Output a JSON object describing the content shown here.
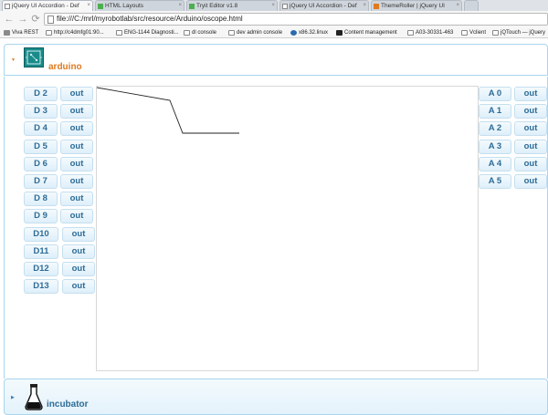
{
  "browser": {
    "tabs": [
      {
        "label": "jQuery UI Accordion - Def",
        "active": true
      },
      {
        "label": "HTML Layouts",
        "active": false
      },
      {
        "label": "Tryit Editor v1.8",
        "active": false
      },
      {
        "label": "jQuery UI Accordion - Def",
        "active": false
      },
      {
        "label": "ThemeRoller | jQuery UI",
        "active": false
      }
    ],
    "url": "file:///C:/mrl/myrobotlab/src/resource/Arduino/oscope.html",
    "bookmarks": [
      "Viva REST",
      "http://c4dmfg01:90...",
      "ENG-1144 Diagnosti...",
      "dl console",
      "dev admin console",
      "x86.32.linux",
      "Content management",
      "A03-30331-463",
      "Vclient",
      "jQTouch — jQuery"
    ]
  },
  "accordion": {
    "arduino_title": "arduino",
    "incubator_title": "incubator"
  },
  "digital_pins": [
    "D 2",
    "D 3",
    "D 4",
    "D 5",
    "D 6",
    "D 7",
    "D 8",
    "D 9",
    "D10",
    "D11",
    "D12",
    "D13"
  ],
  "analog_pins": [
    "A 0",
    "A 1",
    "A 2",
    "A 3",
    "A 4",
    "A 5"
  ],
  "mode_label": "out",
  "colors": {
    "accent_orange": "#e07a1f",
    "header_blue": "#2d6c97",
    "border_blue": "#a8d5ef"
  }
}
